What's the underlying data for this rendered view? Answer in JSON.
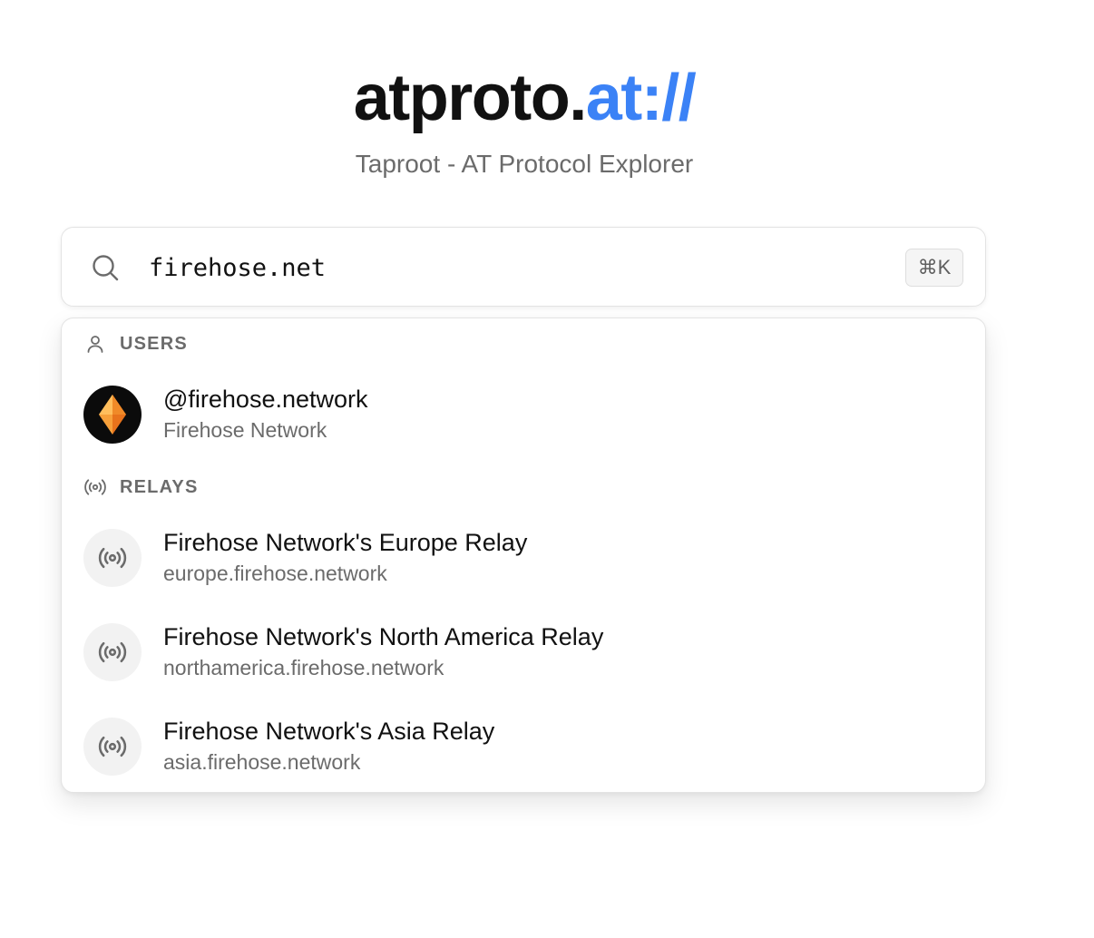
{
  "header": {
    "logo_main": "atproto.",
    "logo_accent": "at://",
    "accent_color": "#3b82f6",
    "subtitle": "Taproot - AT Protocol Explorer"
  },
  "search": {
    "value": "firehose.net",
    "shortcut": "⌘K",
    "icon": "search-icon"
  },
  "results": {
    "users_label": "USERS",
    "users_icon": "user-icon",
    "users": [
      {
        "handle": "@firehose.network",
        "display_name": "Firehose Network",
        "avatar": "orange-diamond-avatar"
      }
    ],
    "relays_label": "RELAYS",
    "relays_icon": "broadcast-icon",
    "relays": [
      {
        "name": "Firehose Network's Europe Relay",
        "host": "europe.firehose.network"
      },
      {
        "name": "Firehose Network's North America Relay",
        "host": "northamerica.firehose.network"
      },
      {
        "name": "Firehose Network's Asia Relay",
        "host": "asia.firehose.network"
      }
    ]
  }
}
